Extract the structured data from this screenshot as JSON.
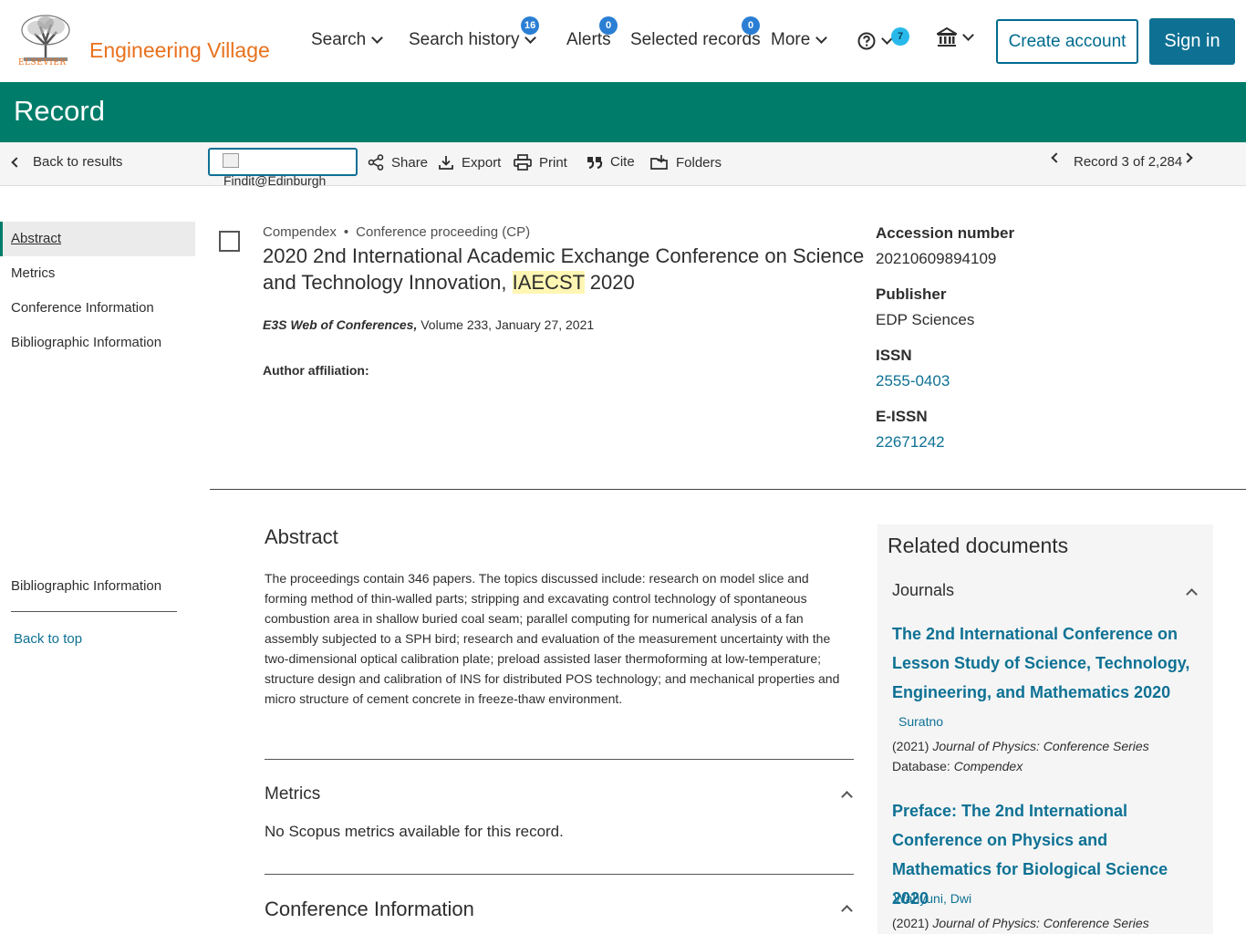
{
  "header": {
    "logo_text": "ELSEVIER",
    "brand": "Engineering Village",
    "nav": {
      "search": "Search",
      "search_history": "Search history",
      "search_history_count": "16",
      "alerts": "Alerts",
      "alerts_count": "0",
      "selected_records": "Selected records",
      "selected_records_count": "0",
      "more": "More",
      "help_count": "7"
    },
    "create_account": "Create account",
    "sign_in": "Sign in"
  },
  "page_title": "Record",
  "toolbar": {
    "back": "Back to results",
    "findit": "Findit@Edinburgh",
    "share": "Share",
    "export": "Export",
    "print": "Print",
    "cite": "Cite",
    "folders": "Folders",
    "record_counter": "Record 3 of 2,284"
  },
  "leftnav": {
    "items": [
      "Abstract",
      "Metrics",
      "Conference Information",
      "Bibliographic Information"
    ],
    "bottom_item": "Bibliographic Information",
    "back_to_top": "Back to top"
  },
  "record": {
    "database": "Compendex",
    "doc_type": "Conference proceeding (CP)",
    "title_before": "2020 2nd International Academic Exchange Conference on Science and Technology Innovation, ",
    "title_highlight": "IAECST",
    "title_after": " 2020",
    "source_journal": "E3S Web of Conferences,",
    "source_detail": " Volume 233, January 27, 2021",
    "author_affiliation_label": "Author affiliation:"
  },
  "meta": {
    "accession_label": "Accession number",
    "accession_value": "20210609894109",
    "publisher_label": "Publisher",
    "publisher_value": "EDP Sciences",
    "issn_label": "ISSN",
    "issn_value": "2555-0403",
    "eissn_label": "E-ISSN",
    "eissn_value": "22671242"
  },
  "abstract": {
    "title": "Abstract",
    "text": "The proceedings contain 346 papers. The topics discussed include: research on model slice and forming method of thin-walled parts; stripping and excavating control technology of spontaneous combustion area in shallow buried coal seam; parallel computing for numerical analysis of a fan assembly subjected to a SPH bird; research and evaluation of the measurement uncertainty with the two-dimensional optical calibration plate; preload assisted laser thermoforming at low-temperature; structure design and calibration of INS for distributed POS technology; and mechanical properties and micro structure of cement concrete in freeze-thaw environment."
  },
  "metrics": {
    "title": "Metrics",
    "text": "No Scopus metrics available for this record."
  },
  "conference_info": {
    "title": "Conference Information"
  },
  "related": {
    "title": "Related documents",
    "journals_label": "Journals",
    "docs": [
      {
        "title": "The 2nd International Conference on Lesson Study of Science, Technology, Engineering, and Mathematics 2020",
        "author": "Suratno",
        "year": "(2021)",
        "journal": "Journal of Physics: Conference Series",
        "database_label": "Database:",
        "database": "Compendex"
      },
      {
        "title": "Preface: The 2nd International Conference on Physics and Mathematics for Biological Science 2020",
        "author": "Wahyuni, Dwi",
        "year": "(2021)",
        "journal": "Journal of Physics: Conference Series"
      }
    ]
  },
  "colors": {
    "brand_orange": "#e9711c",
    "primary_green": "#007d6a",
    "link_blue": "#0e7194",
    "badge_blue": "#2a7fd4"
  }
}
